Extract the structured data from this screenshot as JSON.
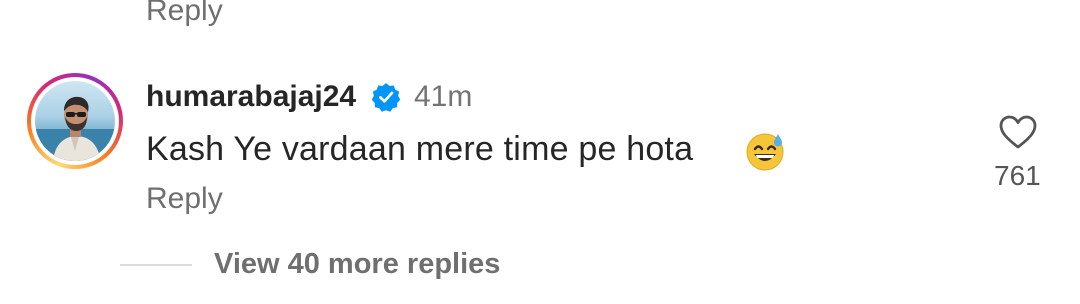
{
  "previous_comment": {
    "reply_label": "Reply"
  },
  "comment": {
    "username": "humarabajaj24",
    "verified": true,
    "time": "41m",
    "text": "Kash Ye vardaan mere time pe hota",
    "emoji": "grinning-face-with-sweat",
    "reply_label": "Reply",
    "like_icon": "heart-outline-icon",
    "like_count": "761"
  },
  "thread": {
    "view_more_label": "View 40 more replies"
  },
  "colors": {
    "verified_blue": "#0095f6",
    "secondary_text": "#737373",
    "primary_text": "#262626"
  }
}
